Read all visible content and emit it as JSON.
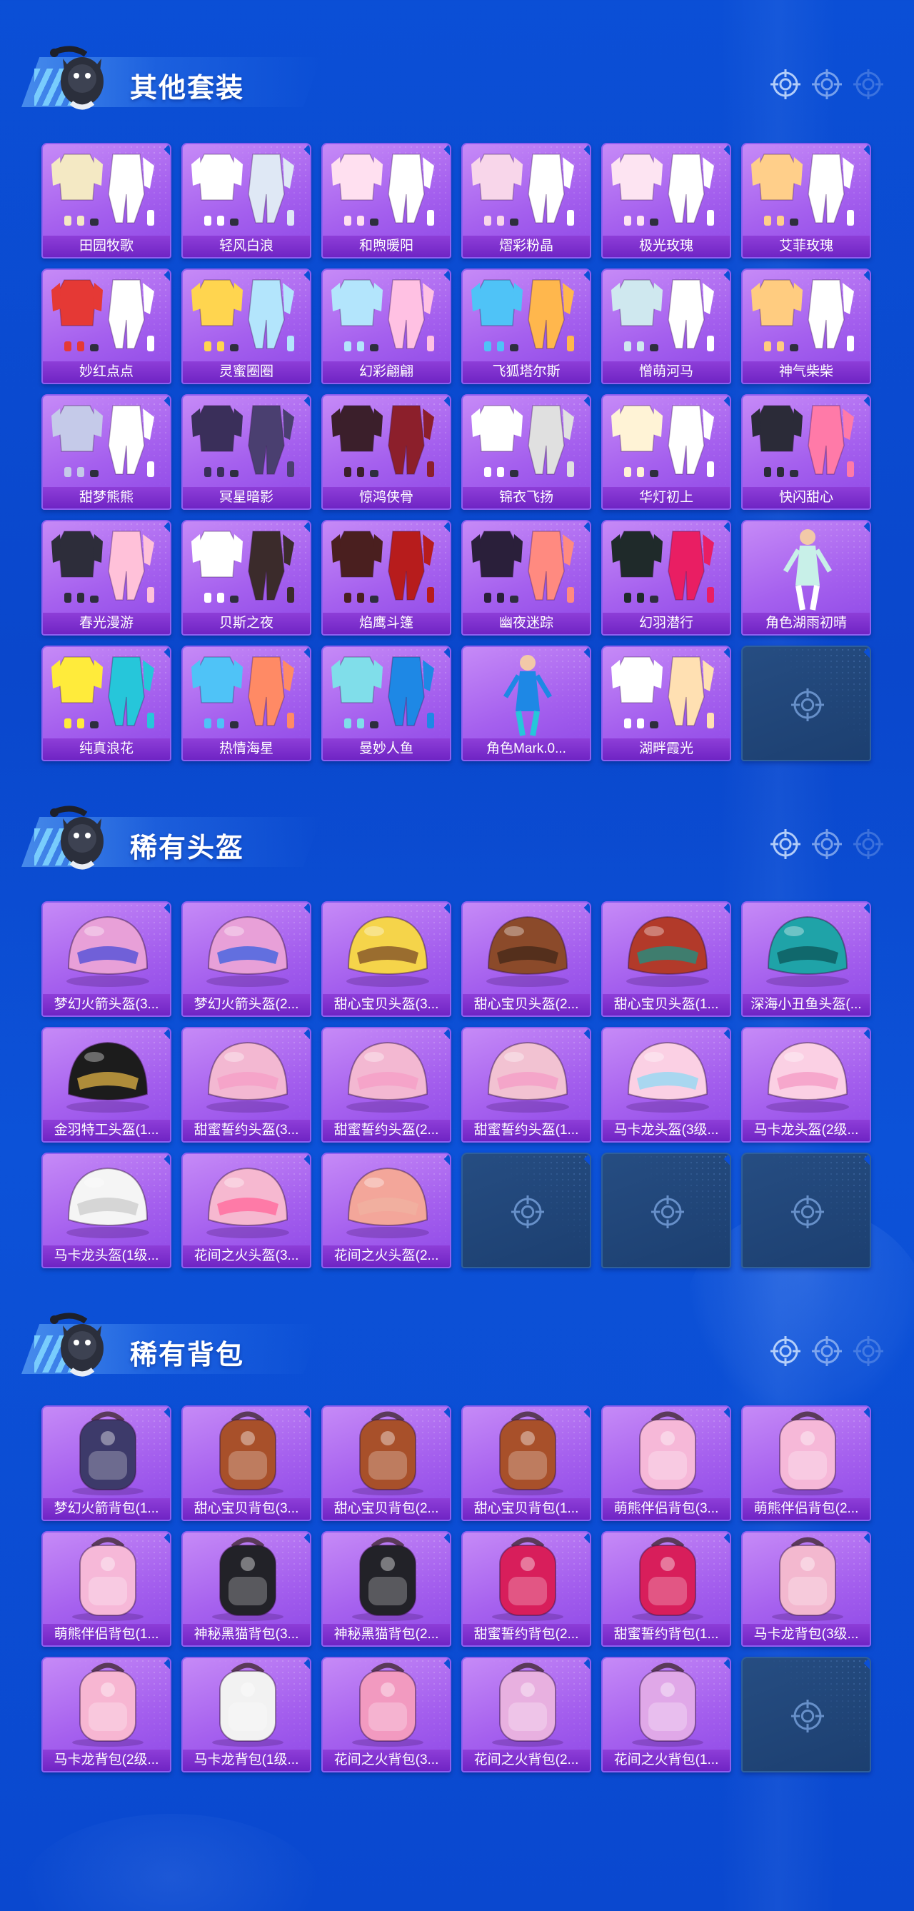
{
  "colors": {
    "background": "#0b4fd6",
    "card_purple": "#a560ee",
    "card_label": "#6f24c4",
    "empty_slot": "#1c3f70"
  },
  "sections": [
    {
      "title": "其他套装",
      "items": [
        "田园牧歌",
        "轻风白浪",
        "和煦暖阳",
        "熠彩粉晶",
        "极光玫瑰",
        "艾菲玫瑰",
        "妙红点点",
        "灵蜜圈圈",
        "幻彩翩翩",
        "飞狐塔尔斯",
        "憎萌河马",
        "神气柴柴",
        "甜梦熊熊",
        "冥星暗影",
        "惊鸿侠骨",
        "锦衣飞扬",
        "华灯初上",
        "快闪甜心",
        "春光漫游",
        "贝斯之夜",
        "焰鹰斗篷",
        "幽夜迷踪",
        "幻羽潜行",
        "角色湖雨初晴",
        "纯真浪花",
        "热情海星",
        "曼妙人鱼",
        "角色Mark.0...",
        "湖畔霞光"
      ],
      "empty_slots": 1
    },
    {
      "title": "稀有头盔",
      "items": [
        "梦幻火箭头盔(3...",
        "梦幻火箭头盔(2...",
        "甜心宝贝头盔(3...",
        "甜心宝贝头盔(2...",
        "甜心宝贝头盔(1...",
        "深海小丑鱼头盔(...",
        "金羽特工头盔(1...",
        "甜蜜誓约头盔(3...",
        "甜蜜誓约头盔(2...",
        "甜蜜誓约头盔(1...",
        "马卡龙头盔(3级...",
        "马卡龙头盔(2级...",
        "马卡龙头盔(1级...",
        "花间之火头盔(3...",
        "花间之火头盔(2..."
      ],
      "empty_slots": 3
    },
    {
      "title": "稀有背包",
      "items": [
        "梦幻火箭背包(1...",
        "甜心宝贝背包(3...",
        "甜心宝贝背包(2...",
        "甜心宝贝背包(1...",
        "萌熊伴侣背包(3...",
        "萌熊伴侣背包(2...",
        "萌熊伴侣背包(1...",
        "神秘黑猫背包(3...",
        "神秘黑猫背包(2...",
        "甜蜜誓约背包(2...",
        "甜蜜誓约背包(1...",
        "马卡龙背包(3级...",
        "马卡龙背包(2级...",
        "马卡龙背包(1级...",
        "花间之火背包(3...",
        "花间之火背包(2...",
        "花间之火背包(1..."
      ],
      "empty_slots": 1
    }
  ]
}
